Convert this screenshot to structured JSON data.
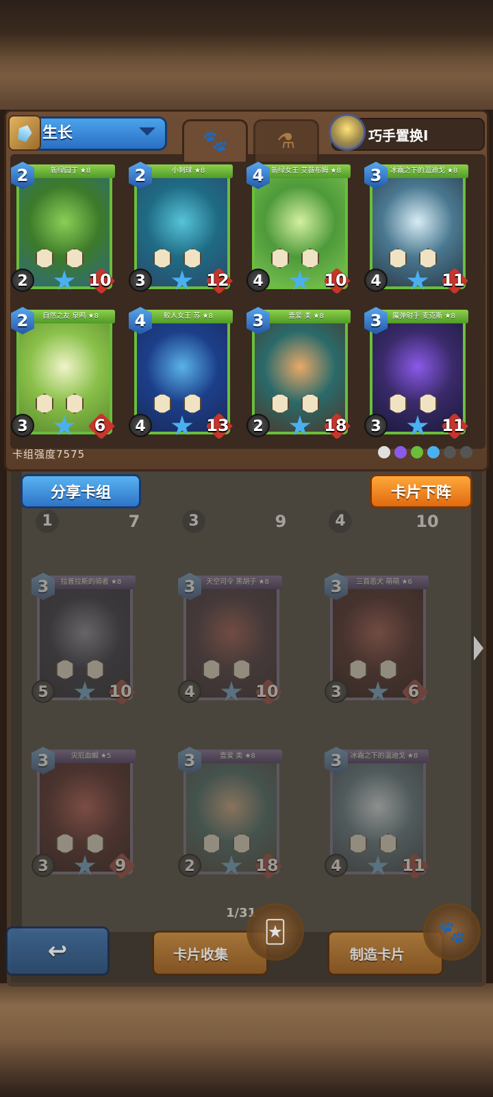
{
  "deck": {
    "name": "生长",
    "strength": "卡组强度7575",
    "skill_name": "巧手置换I",
    "cards": [
      {
        "name": "新绿园丁 ★8",
        "cost": "2",
        "attack": "2",
        "health": "10",
        "colors": [
          "#3d7a2a",
          "#8bcf57",
          "#2e6b7e"
        ]
      },
      {
        "name": "小刺球 ★8",
        "cost": "2",
        "attack": "3",
        "health": "12",
        "colors": [
          "#1f6b84",
          "#56c3d8",
          "#2a4a6a"
        ]
      },
      {
        "name": "新绿女王 艾薇布姆 ★8",
        "cost": "4",
        "attack": "4",
        "health": "10",
        "colors": [
          "#4e9a3a",
          "#d4f0a0",
          "#7bc452"
        ]
      },
      {
        "name": "冰霜之下的温迪戈 ★8",
        "cost": "3",
        "attack": "4",
        "health": "11",
        "colors": [
          "#4a7890",
          "#d8ecf4",
          "#2a3a48"
        ]
      },
      {
        "name": "自然之友 泉鸣 ★8",
        "cost": "2",
        "attack": "3",
        "health": "6",
        "colors": [
          "#8ac04a",
          "#f0f4c8",
          "#5a8a2c"
        ]
      },
      {
        "name": "鲛人女王 苏 ★8",
        "cost": "4",
        "attack": "4",
        "health": "13",
        "colors": [
          "#1c3f8a",
          "#5ab2e8",
          "#1a2a5a"
        ]
      },
      {
        "name": "壹爱 类 ★8",
        "cost": "3",
        "attack": "2",
        "health": "18",
        "colors": [
          "#2a6a6a",
          "#e8a868",
          "#4a3a2a"
        ]
      },
      {
        "name": "魔弹射手 麦克斯 ★8",
        "cost": "3",
        "attack": "3",
        "health": "11",
        "colors": [
          "#3a2a6a",
          "#8a5ae8",
          "#1a1a3a"
        ]
      }
    ]
  },
  "tabs": {
    "active": "paw-icon",
    "inactive": "potion-icon"
  },
  "buttons": {
    "share": "分享卡组",
    "remove": "卡片下阵",
    "collection": "卡片收集",
    "craft": "制造卡片"
  },
  "collection": {
    "page": "1/31",
    "cards": [
      {
        "name": "拉普拉斯的骑者 ★8",
        "cost": "3",
        "attack": "5",
        "health": "10",
        "colors": [
          "#2a2a4a",
          "#8a8aaa",
          "#1a1a2a"
        ]
      },
      {
        "name": "天空司令 黑胡子 ★8",
        "cost": "3",
        "attack": "4",
        "health": "10",
        "colors": [
          "#4a2a3a",
          "#c84a3a",
          "#2a1a2a"
        ]
      },
      {
        "name": "三首恶犬 萌萌 ★6",
        "cost": "3",
        "attack": "3",
        "health": "6",
        "colors": [
          "#5a1a1a",
          "#c84a3a",
          "#2a0a0a"
        ]
      },
      {
        "name": "灾厄血蝎 ★5",
        "cost": "3",
        "attack": "3",
        "health": "9",
        "colors": [
          "#6a1a1a",
          "#e84a3a",
          "#2a0a0a"
        ]
      },
      {
        "name": "壹爱 类 ★8",
        "cost": "3",
        "attack": "2",
        "health": "18",
        "colors": [
          "#2a6a6a",
          "#e8a868",
          "#4a3a2a"
        ]
      },
      {
        "name": "冰霜之下的温迪戈 ★8",
        "cost": "3",
        "attack": "4",
        "health": "11",
        "colors": [
          "#4a7890",
          "#d8ecf4",
          "#2a3a48"
        ]
      }
    ],
    "partial_top_row": [
      {
        "attack": "1",
        "health": "7"
      },
      {
        "attack": "3",
        "health": "9"
      },
      {
        "attack": "4",
        "health": "10"
      }
    ]
  },
  "filters": {
    "colors": [
      "#e0e0e0",
      "#8a5ae8",
      "#6abe3c",
      "#4ab0f0",
      "#555555",
      "#555555"
    ]
  }
}
